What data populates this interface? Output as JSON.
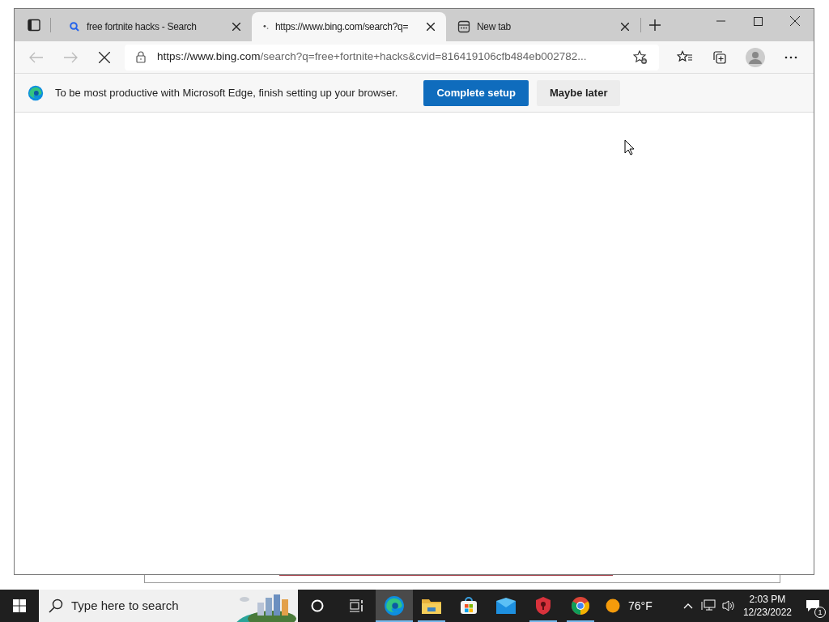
{
  "window": {
    "controls": [
      {
        "kind": "minimize"
      },
      {
        "kind": "maximize"
      },
      {
        "kind": "close"
      }
    ]
  },
  "tabs": [
    {
      "title": "free fortnite hacks - Search",
      "kind": "search",
      "selected": false
    },
    {
      "title": "https://www.bing.com/search?q=",
      "kind": "loading",
      "selected": true
    },
    {
      "title": "New tab",
      "kind": "newtab",
      "selected": false
    }
  ],
  "toolbar": {
    "url_host": "https://www.bing.com",
    "url_rest": "/search?q=free+fortnite+hacks&cvid=816419106cfb484eb002782...",
    "loading": true
  },
  "infobar": {
    "message": "To be most productive with Microsoft Edge, finish setting up your browser.",
    "buttons": [
      {
        "label": "Complete setup",
        "kind": "primary"
      },
      {
        "label": "Maybe later",
        "kind": "secondary"
      }
    ]
  },
  "taskbar": {
    "search_placeholder": "Type here to search",
    "apps": [
      {
        "kind": "edge",
        "running": true,
        "selected": true
      },
      {
        "kind": "files",
        "running": true,
        "selected": false
      },
      {
        "kind": "store",
        "running": false,
        "selected": false
      },
      {
        "kind": "mail",
        "running": false,
        "selected": false
      },
      {
        "kind": "shield",
        "running": true,
        "selected": false
      },
      {
        "kind": "chrome",
        "running": true,
        "selected": false
      }
    ],
    "weather": "76°F",
    "time": "2:03 PM",
    "date": "12/23/2022",
    "notifications": "1"
  }
}
